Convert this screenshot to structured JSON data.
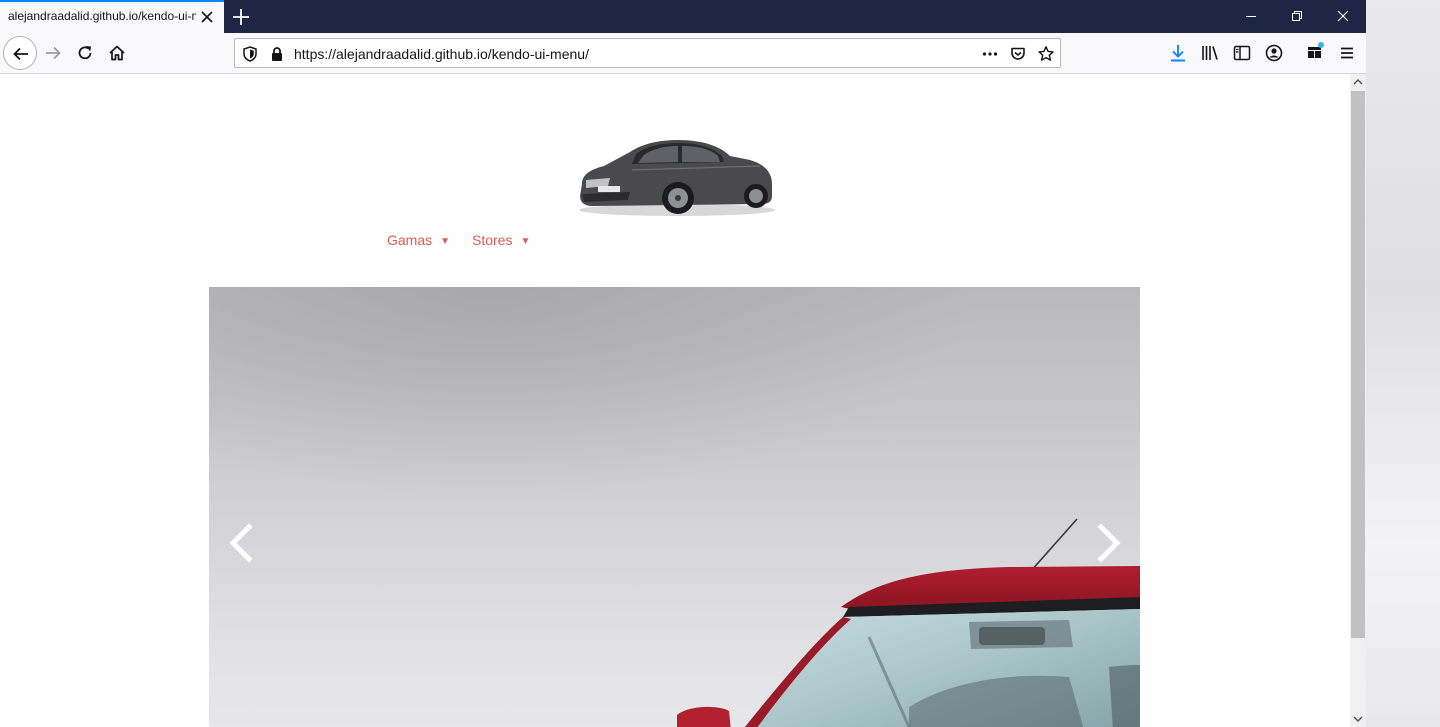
{
  "browser": {
    "tab": {
      "title": "alejandraadalid.github.io/kendo-ui-menu/"
    },
    "url": "https://alejandraadalid.github.io/kendo-ui-menu/"
  },
  "page": {
    "menu": [
      {
        "label": "Gamas",
        "caret": "▼"
      },
      {
        "label": "Stores",
        "caret": "▼"
      }
    ]
  },
  "colors": {
    "menu_text": "#e25a4f",
    "titlebar": "#1f2545",
    "tab_accent": "#0a84ff"
  }
}
